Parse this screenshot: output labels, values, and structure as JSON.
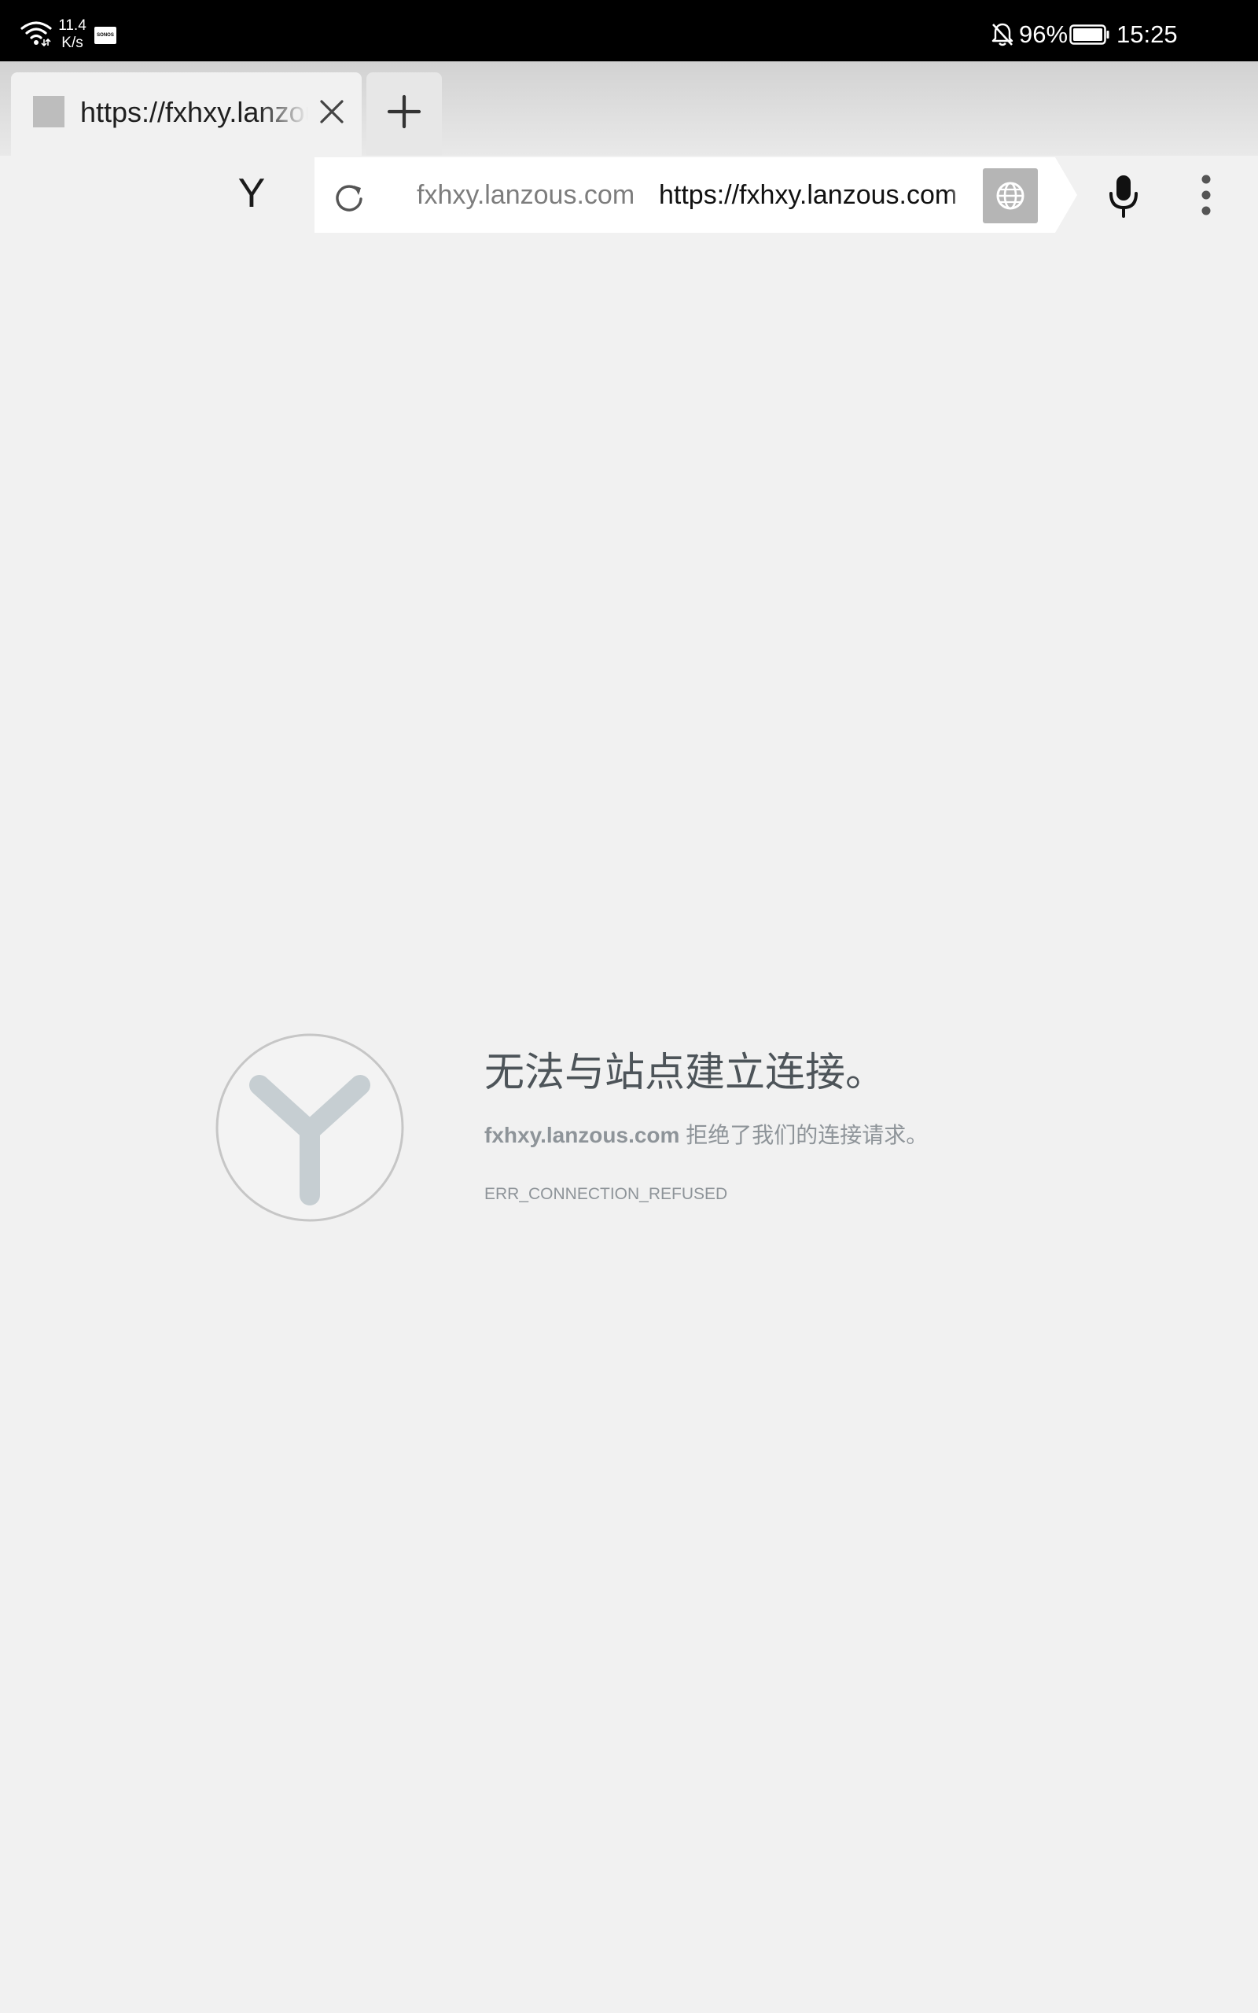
{
  "status_bar": {
    "net_speed_value": "11.4",
    "net_speed_unit": "K/s",
    "notification_badge": "SONOS",
    "battery_percent": "96%",
    "time": "15:25"
  },
  "tabs": [
    {
      "title": "https://fxhxy.lanzous.com"
    }
  ],
  "toolbar": {
    "home_logo": "Y",
    "omnibox_domain": "fxhxy.lanzous.com",
    "omnibox_url": "https://fxhxy.lanzous.com"
  },
  "error": {
    "title": "无法与站点建立连接。",
    "host": "fxhxy.lanzous.com",
    "message": "拒绝了我们的连接请求。",
    "code": "ERR_CONNECTION_REFUSED"
  },
  "icons": {
    "wifi": "wifi-icon",
    "bell_off": "bell-off-icon",
    "battery": "battery-icon",
    "close": "close-icon",
    "plus": "plus-icon",
    "reload": "reload-icon",
    "globe": "globe-icon",
    "mic": "mic-icon",
    "menu": "more-vert-icon",
    "logo": "yandex-logo-icon"
  }
}
